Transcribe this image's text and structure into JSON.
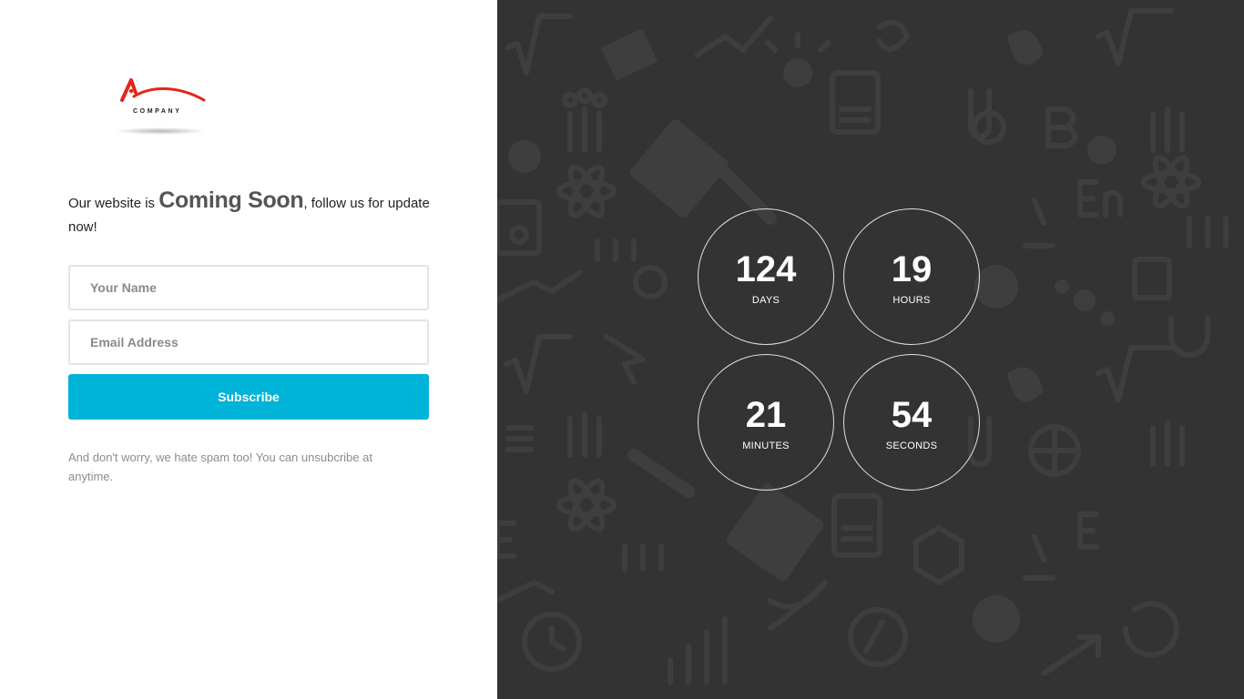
{
  "logo": {
    "caption": "COMPANY"
  },
  "headline": {
    "prefix": "Our website is ",
    "highlight": "Coming Soon",
    "suffix": ", follow us for update now!"
  },
  "form": {
    "name_placeholder": "Your Name",
    "email_placeholder": "Email Address",
    "subscribe_label": "Subscribe",
    "note": "And don't worry, we hate spam too! You can unsubcribe at anytime."
  },
  "countdown": {
    "days": {
      "value": "124",
      "label": "DAYS"
    },
    "hours": {
      "value": "19",
      "label": "HOURS"
    },
    "minutes": {
      "value": "21",
      "label": "MINUTES"
    },
    "seconds": {
      "value": "54",
      "label": "SECONDS"
    }
  },
  "colors": {
    "accent": "#00b3d8",
    "right_bg": "#333333",
    "logo_red": "#e3261c"
  },
  "background_icons": [
    "sqrt-icon",
    "atom-icon",
    "calculator-icon",
    "microscope-icon",
    "apple-icon",
    "globe-icon",
    "compass-icon",
    "lightbulb-icon",
    "people-icon",
    "chart-icon",
    "leaf-icon",
    "test-tube-icon",
    "clock-icon",
    "book-icon",
    "magnet-icon",
    "molecule-icon",
    "dna-icon",
    "puzzle-icon"
  ]
}
